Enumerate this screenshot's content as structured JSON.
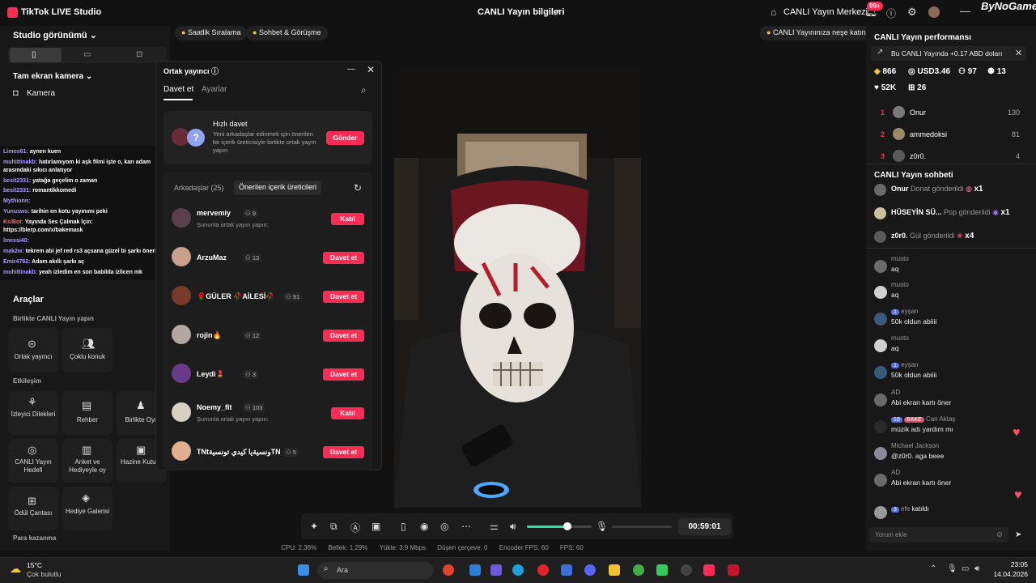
{
  "titlebar": {
    "app_title": "TikTok LIVE Studio",
    "live_info": "CANLI Yayın bilgileri",
    "live_center": "CANLI Yayın Merkezi",
    "notif_count": "99+",
    "watermark": "ByNoGame"
  },
  "left": {
    "studio_view": "Studio görünümü",
    "fullscreen_camera": "Tam ekran kamera",
    "camera": "Kamera",
    "chat": [
      {
        "name": "Limos61:",
        "text": "aynen kuen"
      },
      {
        "name": "muhittinakb:",
        "text": "hatırlamıyom ki aşk filmi işte o, karı adam"
      },
      {
        "name": "",
        "text": "arasındaki sıkıcı anlatıyor"
      },
      {
        "name": "besit2331:",
        "text": "yatağa geçelim o zaman"
      },
      {
        "name": "besit2331:",
        "text": "romantikkomedi"
      },
      {
        "name": "Mythionn:",
        "text": ""
      },
      {
        "name": "Yunusws:",
        "text": "tarihin en kotu yayınımı peki"
      },
      {
        "name": "Ks/Bot:",
        "text": "Yayında Ses Çalmak İçin:"
      },
      {
        "name": "",
        "text": "https://blerp.com/x/bakemask"
      },
      {
        "name": "lmessi40:",
        "text": ""
      },
      {
        "name": "mak2w:",
        "text": "tekrem abi jef red rs3 açsana güzel bi şarkı önerim"
      },
      {
        "name": "Emir4762:",
        "text": "Adam akıllı şarkı aç"
      },
      {
        "name": "muhittinakb:",
        "text": "yeah izledim en son babilda izlicen mk"
      }
    ],
    "tools_title": "Araçlar",
    "together_live": "Birlikte CANLI Yayın yapın",
    "tool_cohost": "Ortak yayıncı",
    "tool_multiguest": "Çoklu konuk",
    "interaction": "Etkileşim",
    "tool_viewer_wishes": "İzleyici Dilekleri",
    "tool_guide": "Rehber",
    "tool_play_together": "Birlikte Oyn",
    "tool_live_goal": "CANLI Yayın Hedefi",
    "tool_poll": "Anket ve Hediyeyle oy",
    "tool_treasure": "Hazine Kutusu",
    "tool_prize_bag": "Ödül Çantası",
    "tool_gift_gallery": "Hediye Galerisi",
    "money": "Para kazanma"
  },
  "pills": {
    "hourly_ranking": "Saatlik Sıralama",
    "chat_meet": "Sohbet & Görüşme",
    "add_joy": "CANLI Yayınınıza neşe katın"
  },
  "cohost": {
    "title": "Ortak yayıncı",
    "tab_invite": "Davet et",
    "tab_settings": "Ayarlar",
    "quick_title": "Hızlı davet",
    "quick_desc": "Yeni arkadaşlar edinmek için önerilen bir içerik üreticisiyle birlikte ortak yayın yapın",
    "send": "Gönder",
    "friends_tab": "Arkadaşlar (25)",
    "suggested_tab": "Önerilen içerik üreticileri",
    "rows": [
      {
        "name": "mervemiy",
        "count": "9",
        "sub": "Şununla ortak yayın yapın:",
        "button": "Katıl",
        "color": "#5b3f4a"
      },
      {
        "name": "ArzuMaz",
        "count": "13",
        "sub": "",
        "button": "Davet et",
        "color": "#c9a08a"
      },
      {
        "name": "🌹GÜLER 🥀AİLESİ🥀",
        "count": "91",
        "sub": "",
        "button": "Davet et",
        "color": "#7a3a2a"
      },
      {
        "name": "rojin🔥",
        "count": "12",
        "sub": "",
        "button": "Davet et",
        "color": "#b4a6a0"
      },
      {
        "name": "Leydi💄",
        "count": "3",
        "sub": "",
        "button": "Davet et",
        "color": "#6a3a8a"
      },
      {
        "name": "Noemy_fit",
        "count": "103",
        "sub": "Şununla ortak yayın yapın:",
        "button": "Katıl",
        "color": "#d8d0c0"
      },
      {
        "name": "TNtونسيةيا كيدي تونسيةTN",
        "count": "5",
        "sub": "",
        "button": "Davet et",
        "color": "#e0b090"
      }
    ]
  },
  "controls": {
    "timer": "00:59:01",
    "volume_level": 0.62,
    "stats": {
      "cpu": "CPU: 2.36%",
      "memory": "Bellek: 1.29%",
      "upload": "Yükle: 3.9 Mbps",
      "dropped": "Düşen çerçeve: 0",
      "encoder_fps": "Encoder FPS: 60",
      "fps": "FPS: 60"
    }
  },
  "right": {
    "perf_title": "CANLI Yayın performansı",
    "earnings": "Bu CANLI Yayında +0.17 ABD doları",
    "stats": [
      "866",
      "USD3.46",
      "97",
      "13",
      "52K",
      "26"
    ],
    "ranking": [
      {
        "rank": "1",
        "name": "Onur",
        "value": "130"
      },
      {
        "rank": "2",
        "name": "ammedoksi",
        "value": "81"
      },
      {
        "rank": "3",
        "name": "z0r0.",
        "value": "4"
      }
    ],
    "chat_title": "CANLI Yayın sohbeti",
    "gifts": [
      {
        "name": "Onur",
        "action": "Donat gönderildi",
        "count": "x1"
      },
      {
        "name": "HÜSEYİN SÜ...",
        "action": "Pop gönderildi",
        "count": "x1"
      },
      {
        "name": "z0r0.",
        "action": "Gül gönderildi",
        "count": "x4"
      }
    ],
    "messages": [
      {
        "name": "musto",
        "text": "aq"
      },
      {
        "name": "musto",
        "text": "aq"
      },
      {
        "name": "eyşan",
        "text": "50k oldun abiiii",
        "badge": "1"
      },
      {
        "name": "musto",
        "text": "aq"
      },
      {
        "name": "eyşan",
        "text": "50k oldun abiiii",
        "badge": "1"
      },
      {
        "name": "AD",
        "text": "Abi ekran kartı öner"
      },
      {
        "name": "Can Aktaş",
        "text": "müzik adı yardım mı",
        "badge": "10",
        "badge2": "BAKE"
      },
      {
        "name": "Michael Jackson",
        "text": "@z0r0. aga beee"
      },
      {
        "name": "AD",
        "text": "Abi ekran kartı öner"
      },
      {
        "name": "efe",
        "text": "katıldı",
        "badge": "3"
      }
    ],
    "comment_placeholder": "Yorum ekle"
  },
  "taskbar": {
    "temp": "15°C",
    "weather": "Çok bulutlu",
    "search_placeholder": "Ara",
    "time": "23:05",
    "date": "14.04.2026"
  }
}
